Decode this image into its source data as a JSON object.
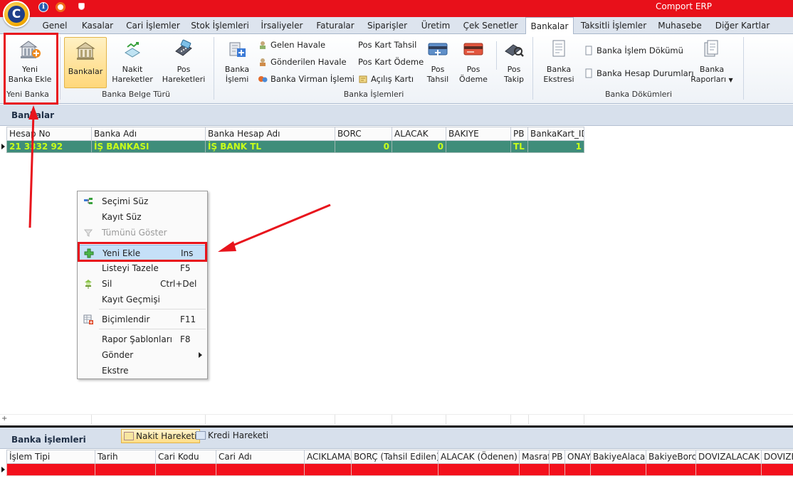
{
  "app": {
    "title": "Comport ERP",
    "logo_letter": "C",
    "info_glyph": "i"
  },
  "tabs": [
    "Genel",
    "Kasalar",
    "Cari İşlemler",
    "Stok İşlemleri",
    "İrsaliyeler",
    "Faturalar",
    "Siparişler",
    "Üretim",
    "Çek Senetler",
    "Bankalar",
    "Taksitli İşlemler",
    "Muhasebe",
    "Diğer Kartlar"
  ],
  "active_tab": "Bankalar",
  "ribbon": {
    "yeni_banka": {
      "line1": "Yeni",
      "line2": "Banka Ekle",
      "group": "Yeni Banka"
    },
    "banka_belge": {
      "bankalar": "Bankalar",
      "nakit1": "Nakit",
      "nakit2": "Hareketler",
      "pos1": "Pos",
      "pos2": "Hareketleri",
      "group": "Banka Belge Türü"
    },
    "banka_islemleri": {
      "islem1": "Banka",
      "islem2": "İşlemi",
      "gelen_havale": "Gelen Havale",
      "gonderilen_havale": "Gönderilen Havale",
      "virman": "Banka Virman İşlemi",
      "pos_kart_tahsil": "Pos Kart Tahsil",
      "pos_kart_odeme": "Pos Kart Ödeme",
      "acilis_karti": "Açılış Kartı",
      "pos_tahsil1": "Pos",
      "pos_tahsil2": "Tahsil",
      "pos_odeme1": "Pos",
      "pos_odeme2": "Ödeme",
      "pos_takip1": "Pos",
      "pos_takip2": "Takip",
      "group": "Banka İşlemleri"
    },
    "banka_dokumleri": {
      "ekstre1": "Banka",
      "ekstre2": "Ekstresi",
      "islem_dokumu": "Banka İşlem Dökümü",
      "hesap_durumlari": "Banka Hesap Durumları",
      "raporlar1": "Banka",
      "raporlar2": "Raporları",
      "group": "Banka Dökümleri"
    }
  },
  "bankalar": {
    "title": "Bankalar",
    "columns": [
      "Hesap No",
      "Banka Adı",
      "Banka Hesap Adı",
      "BORC",
      "ALACAK",
      "BAKIYE",
      "PB",
      "BankaKart_ID"
    ],
    "rows": [
      [
        "21 3332 92",
        "İŞ BANKASI",
        "İŞ BANK TL",
        "0",
        "0",
        "",
        "TL",
        "1"
      ]
    ]
  },
  "context_menu": {
    "items": [
      {
        "label": "Seçimi Süz",
        "shortcut": "",
        "icon": "filter-selection-icon"
      },
      {
        "label": "Kayıt Süz",
        "shortcut": "",
        "icon": ""
      },
      {
        "label": "Tümünü Göster",
        "shortcut": "",
        "icon": "show-all-icon"
      },
      {
        "label": "Yeni Ekle",
        "shortcut": "Ins",
        "icon": "add-icon"
      },
      {
        "label": "Listeyi Tazele",
        "shortcut": "F5",
        "icon": ""
      },
      {
        "label": "Sil",
        "shortcut": "Ctrl+Del",
        "icon": "delete-icon"
      },
      {
        "label": "Kayıt Geçmişi",
        "shortcut": "",
        "icon": ""
      },
      {
        "label": "Biçimlendir",
        "shortcut": "F11",
        "icon": "format-icon"
      },
      {
        "label": "Rapor Şablonları",
        "shortcut": "F8",
        "icon": ""
      },
      {
        "label": "Gönder",
        "shortcut": "",
        "icon": ""
      },
      {
        "label": "Ekstre",
        "shortcut": "",
        "icon": ""
      }
    ]
  },
  "banka_islemleri": {
    "title": "Banka İşlemleri",
    "tabs": [
      "Nakit Hareketi",
      "Kredi Hareketi"
    ],
    "active_tab": "Nakit Hareketi",
    "columns": [
      "İşlem Tipi",
      "Tarih",
      "Cari Kodu",
      "Cari Adı",
      "ACIKLAMA",
      "BORÇ (Tahsil Edilen)",
      "ALACAK (Ödenen)",
      "Masraf",
      "PB",
      "ONAY",
      "BakiyeAlacak",
      "BakiyeBorc",
      "DOVIZALACAK",
      "DOVIZBORC"
    ]
  },
  "colors": {
    "title_bar": "#e8101a",
    "selected_row": "#3f8d7a",
    "selected_row_text": "#c8ff1a",
    "annotation": "#e8141c",
    "bottom_row": "#f3101c"
  }
}
